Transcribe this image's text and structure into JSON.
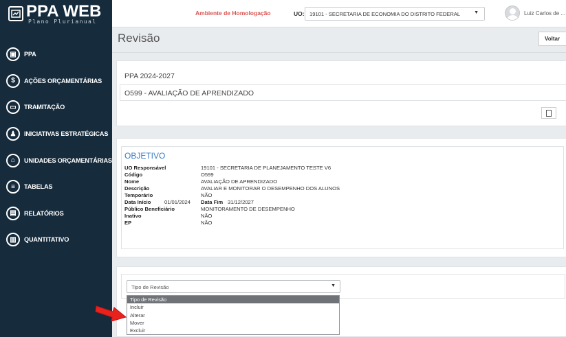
{
  "brand": {
    "title": "PPA WEB",
    "subtitle": "Plano Plurianual"
  },
  "sidebar": {
    "items": [
      {
        "label": "PPA",
        "icon": "ppa-icon"
      },
      {
        "label": "AÇÕES ORÇAMENTÁRIAS",
        "icon": "dollar-icon"
      },
      {
        "label": "TRAMITAÇÃO",
        "icon": "lock-icon"
      },
      {
        "label": "INICIATIVAS ESTRATÉGICAS",
        "icon": "strategy-icon"
      },
      {
        "label": "UNIDADES ORÇAMENTÁRIAS",
        "icon": "bank-icon"
      },
      {
        "label": "TABELAS",
        "icon": "table-icon"
      },
      {
        "label": "RELATÓRIOS",
        "icon": "report-icon"
      },
      {
        "label": "QUANTITATIVO",
        "icon": "chart-icon"
      }
    ]
  },
  "header": {
    "environment": "Ambiente de Homologação",
    "uo_label": "UO:",
    "uo_value": "19101 - SECRETARIA DE ECONOMIA DO DISTRITO FEDERAL",
    "user_name": "Luiz Carlos de ..."
  },
  "page": {
    "title": "Revisão",
    "back_label": "Voltar"
  },
  "summary": {
    "ppa": "PPA 2024-2027",
    "program": "O599 - AVALIAÇÃO DE APRENDIZADO"
  },
  "objective": {
    "title": "OBJETIVO",
    "fields": {
      "uo_label": "UO Responsável",
      "uo_value": "19101 - SECRETARIA DE PLANEJAMENTO TESTE V6",
      "codigo_label": "Código",
      "codigo_value": "O599",
      "nome_label": "Nome",
      "nome_value": "AVALIAÇÃO DE APRENDIZADO",
      "descricao_label": "Descrição",
      "descricao_value": "AVALIAR E MONITORAR O DESEMPENHO DOS ALUNOS",
      "temporario_label": "Temporário",
      "temporario_value": "NÃO",
      "inicio_label": "Data Início",
      "inicio_value": "01/01/2024",
      "fim_label": "Data Fim",
      "fim_value": "31/12/2027",
      "publico_label": "Público Beneficiário",
      "publico_value": "MONITORAMENTO DE DESEMPENHO",
      "inativo_label": "Inativo",
      "inativo_value": "NÃO",
      "ep_label": "EP",
      "ep_value": "NÃO"
    }
  },
  "revision": {
    "placeholder": "Tipo de Revisão",
    "options": [
      "Tipo de Revisão",
      "Incluir",
      "Alterar",
      "Mover",
      "Excluir"
    ]
  },
  "colors": {
    "sidebar_bg": "#162b3c",
    "environment": "#d9534f",
    "objective_title": "#3a7cc4",
    "selected_option": "#6f7377",
    "arrow": "#e8231e"
  }
}
